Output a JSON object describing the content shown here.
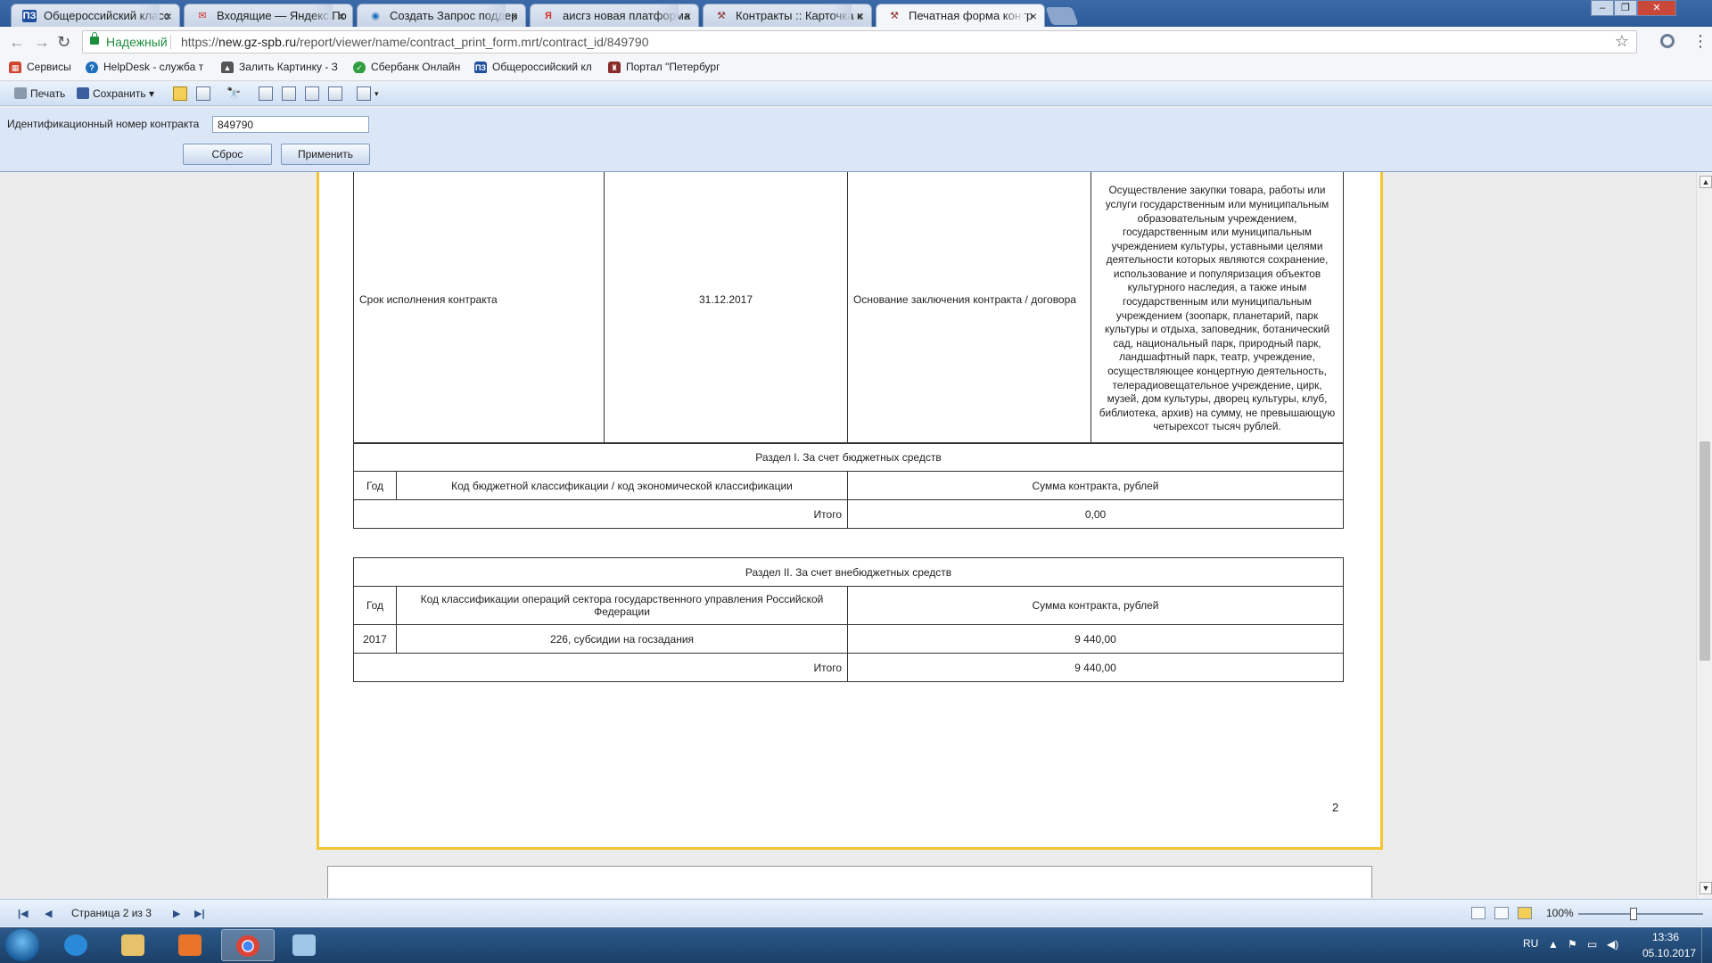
{
  "browser": {
    "tabs": [
      {
        "label": "Общероссийский класс",
        "favicon": "ПЗ"
      },
      {
        "label": "Входящие — Яндекс.По",
        "favicon": "✉"
      },
      {
        "label": "Создать Запрос поддер",
        "favicon": "◉"
      },
      {
        "label": "аисгз новая платформа",
        "favicon": "Я"
      },
      {
        "label": "Контракты :: Карточка к",
        "favicon": "⚒"
      },
      {
        "label": "Печатная форма контр",
        "favicon": "⚒"
      }
    ],
    "secure_label": "Надежный",
    "url_scheme": "https://",
    "url_host": "new.gz-spb.ru",
    "url_path": "/report/viewer/name/contract_print_form.mrt/contract_id/849790",
    "bookmarks": [
      {
        "label": "Сервисы",
        "icon": "apps-grid-icon",
        "color": "#d0452f"
      },
      {
        "label": "HelpDesk - служба т",
        "icon": "helpdesk-icon",
        "color": "#1f6fbf"
      },
      {
        "label": "Залить Картинку - З",
        "icon": "image-upload-icon",
        "color": "#555555"
      },
      {
        "label": "Сбербанк Онлайн",
        "icon": "sberbank-icon",
        "color": "#2e9e3e"
      },
      {
        "label": "Общероссийский кл",
        "icon": "classifier-icon",
        "color": "#1f4f9f"
      },
      {
        "label": "Портал \"Петербург",
        "icon": "spb-portal-icon",
        "color": "#8a2b2b"
      }
    ]
  },
  "viewer": {
    "toolbar": {
      "print_label": "Печать",
      "save_label": "Сохранить"
    },
    "params": {
      "label": "Идентификационный номер контракта",
      "value": "849790",
      "reset_label": "Сброс",
      "apply_label": "Применить"
    },
    "status": {
      "page_info": "Страница 2 из 3",
      "zoom": "100%"
    }
  },
  "report": {
    "row_term": {
      "label": "Срок исполнения контракта",
      "date": "31.12.2017",
      "basis_label": "Основание заключения контракта / договора",
      "basis_text": "Осуществление закупки товара, работы или услуги государственным или муниципальным образовательным учреждением, государственным или муниципальным учреждением культуры, уставными целями деятельности которых являются сохранение, использование и популяризация объектов культурного наследия, а также иным государственным или муниципальным учреждением (зоопарк, планетарий, парк культуры и отдыха, заповедник, ботанический сад, национальный парк, природный парк, ландшафтный парк, театр, учреждение, осуществляющее концертную деятельность, телерадиовещательное учреждение, цирк, музей, дом культуры, дворец культуры, клуб, библиотека, архив) на сумму, не превышающую четырехсот тысяч рублей."
    },
    "section1": {
      "title": "Раздел I. За счет бюджетных средств",
      "col_year": "Год",
      "col_code": "Код бюджетной классификации / код экономической классификации",
      "col_sum": "Сумма контракта, рублей",
      "total_label": "Итого",
      "total_value": "0,00"
    },
    "section2": {
      "title": "Раздел II. За счет внебюджетных средств",
      "col_year": "Год",
      "col_code": "Код классификации операций сектора государственного управления Российской Федерации",
      "col_sum": "Сумма контракта, рублей",
      "rows": [
        {
          "year": "2017",
          "code": "226, субсидии на госзадания",
          "sum": "9 440,00"
        }
      ],
      "total_label": "Итого",
      "total_value": "9 440,00"
    },
    "page_number": "2"
  },
  "taskbar": {
    "lang": "RU",
    "time": "13:36",
    "date": "05.10.2017"
  },
  "colors": {
    "page_border": "#f4c531",
    "toolbar_bg": "#dbe7f6",
    "secure_green": "#1e8e3e"
  }
}
